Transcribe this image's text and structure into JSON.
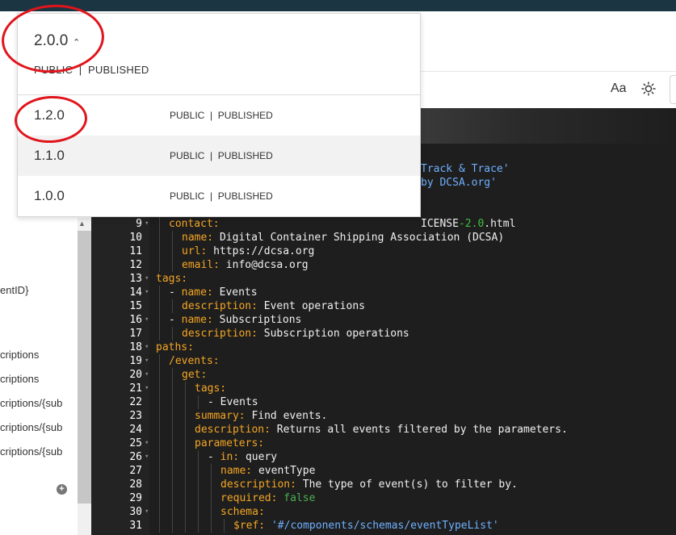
{
  "toolbar": {
    "font_label": "Aa",
    "theme_icon": "sun-icon"
  },
  "dropdown": {
    "selected_version": "2.0.0",
    "selected_status": "PUBLIC  |  PUBLISHED",
    "options": [
      {
        "version": "1.2.0",
        "status": "PUBLIC  |  PUBLISHED"
      },
      {
        "version": "1.1.0",
        "status": "PUBLIC  |  PUBLISHED"
      },
      {
        "version": "1.0.0",
        "status": "PUBLIC  |  PUBLISHED"
      }
    ]
  },
  "left_items": [
    "entID}",
    "criptions",
    "criptions",
    "criptions/{sub",
    "criptions/{sub",
    "criptions/{sub"
  ],
  "editor": {
    "partial_1": "Track & Trace'",
    "partial_2": "by DCSA.org'",
    "partial_3a": "ICENSE",
    "partial_3b": "-2.0",
    "partial_3c": ".html",
    "lines": [
      {
        "n": "9",
        "fold": true,
        "key": "contact:",
        "val": ""
      },
      {
        "n": "10",
        "fold": false,
        "key": "name:",
        "val": " Digital Container Shipping Association (DCSA)"
      },
      {
        "n": "11",
        "fold": false,
        "key": "url:",
        "val": " https://dcsa.org"
      },
      {
        "n": "12",
        "fold": false,
        "key": "email:",
        "val": " info@dcsa.org"
      },
      {
        "n": "13",
        "fold": true,
        "key": "tags:",
        "val": ""
      },
      {
        "n": "14",
        "fold": true,
        "key": "name:",
        "val": " Events"
      },
      {
        "n": "15",
        "fold": false,
        "key": "description:",
        "val": " Event operations"
      },
      {
        "n": "16",
        "fold": true,
        "key": "name:",
        "val": " Subscriptions"
      },
      {
        "n": "17",
        "fold": false,
        "key": "description:",
        "val": " Subscription operations"
      },
      {
        "n": "18",
        "fold": true,
        "key": "paths:",
        "val": ""
      },
      {
        "n": "19",
        "fold": true,
        "key": "/events:",
        "val": ""
      },
      {
        "n": "20",
        "fold": true,
        "key": "get:",
        "val": ""
      },
      {
        "n": "21",
        "fold": true,
        "key": "tags:",
        "val": ""
      },
      {
        "n": "22",
        "fold": false,
        "key": "",
        "val": "- Events"
      },
      {
        "n": "23",
        "fold": false,
        "key": "summary:",
        "val": " Find events."
      },
      {
        "n": "24",
        "fold": false,
        "key": "description:",
        "val": " Returns all events filtered by the parameters."
      },
      {
        "n": "25",
        "fold": true,
        "key": "parameters:",
        "val": ""
      },
      {
        "n": "26",
        "fold": true,
        "key": "in:",
        "val": " query"
      },
      {
        "n": "27",
        "fold": false,
        "key": "name:",
        "val": " eventType"
      },
      {
        "n": "28",
        "fold": false,
        "key": "description:",
        "val": " The type of event(s) to filter by."
      },
      {
        "n": "29",
        "fold": false,
        "key": "required:",
        "val": " false"
      },
      {
        "n": "30",
        "fold": true,
        "key": "schema:",
        "val": ""
      },
      {
        "n": "31",
        "fold": false,
        "key": "$ref:",
        "val": " '#/components/schemas/eventTypeList'"
      }
    ]
  }
}
